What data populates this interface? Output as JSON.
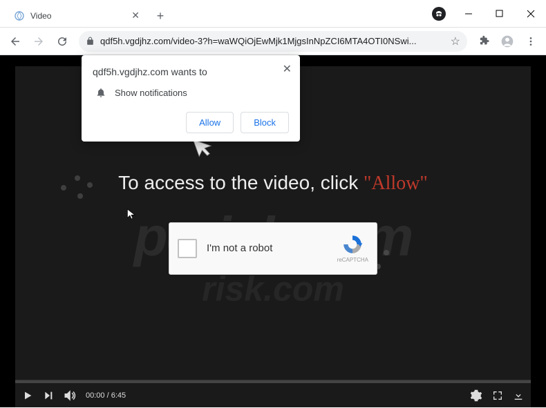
{
  "window": {
    "tab_title": "Video",
    "url": "qdf5h.vgdjhz.com/video-3?h=waWQiOjEwMjk1MjgsInNpZCI6MTA4OTI0NSwi..."
  },
  "notification": {
    "site_wants": "qdf5h.vgdjhz.com wants to",
    "permission_label": "Show notifications",
    "allow_label": "Allow",
    "block_label": "Block"
  },
  "page": {
    "main_text_prefix": "To access to the video, click ",
    "main_text_allow": "\"Allow\"",
    "recaptcha_label": "I'm not a robot",
    "recaptcha_brand": "reCAPTCHA"
  },
  "player": {
    "current_time": "00:00",
    "duration": "6:45"
  },
  "watermark": {
    "text1": "pcrisk.com",
    "text2": "risk.com"
  }
}
